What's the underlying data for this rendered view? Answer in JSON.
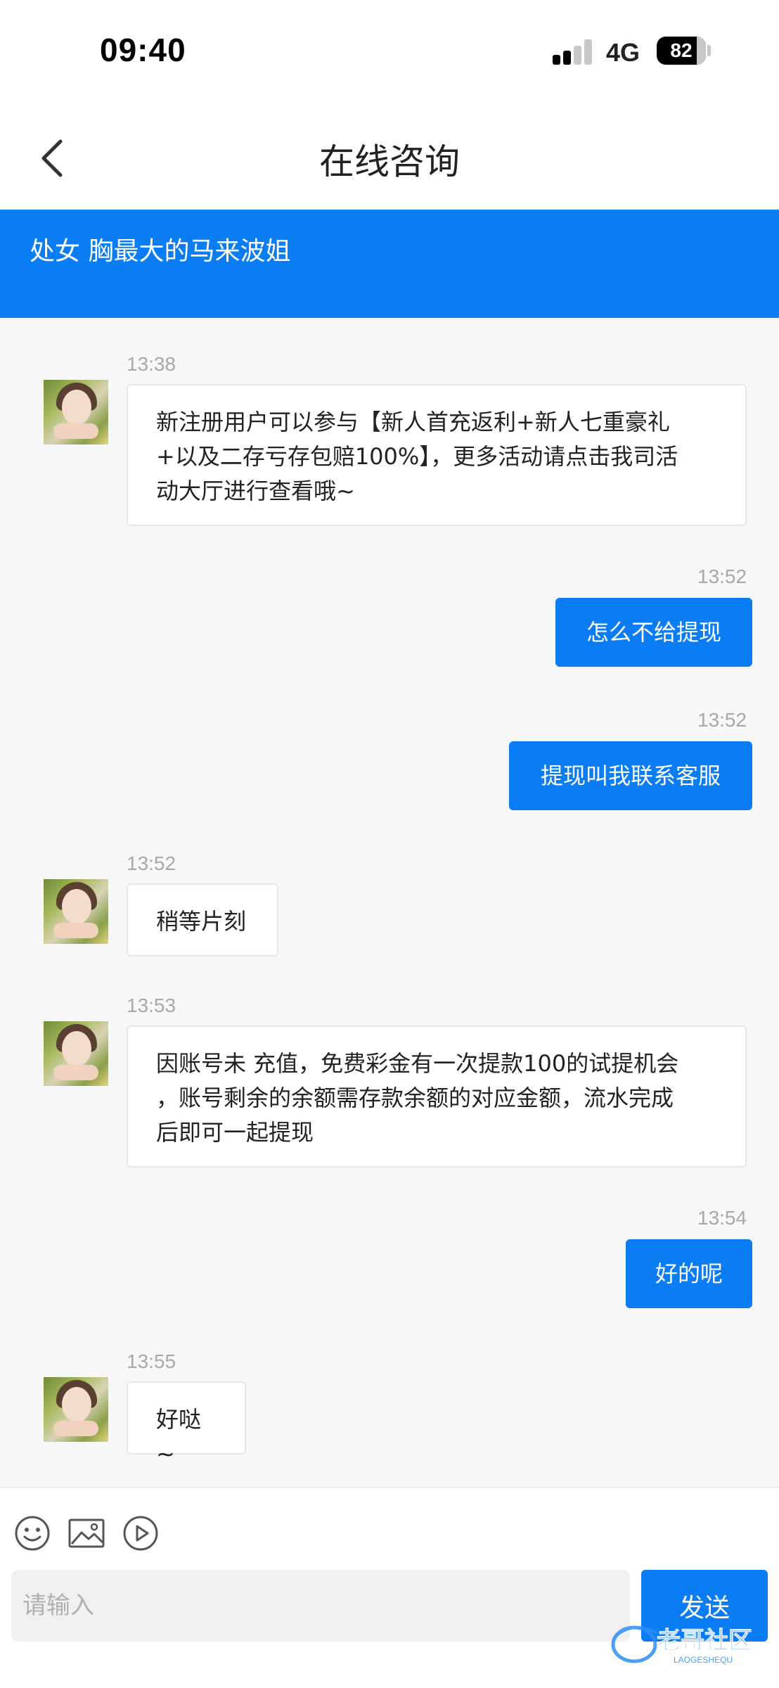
{
  "status_bar": {
    "time": "09:40",
    "network": "4G",
    "battery": "82",
    "battery_level": 0.82
  },
  "header": {
    "title": "在线咨询",
    "back_icon": "chevron-left-icon"
  },
  "banner": {
    "text": "处女 胸最大的马来波姐"
  },
  "messages": [
    {
      "side": "left",
      "time": "13:38",
      "text_lines": [
        "新注册用户可以参与【新人首充返利+新人七重豪礼",
        "+以及二存亏存包赔100%】，更多活动请点击我司活",
        "动大厅进行查看哦~"
      ]
    },
    {
      "side": "right",
      "time": "13:52",
      "text": "怎么不给提现"
    },
    {
      "side": "right",
      "time": "13:52",
      "text": "提现叫我联系客服"
    },
    {
      "side": "left",
      "time": "13:52",
      "text_lines": [
        "稍等片刻"
      ]
    },
    {
      "side": "left",
      "time": "13:53",
      "text_lines": [
        "因账号未 充值，免费彩金有一次提款100的试提机会",
        "，账号剩余的余额需存款余额的对应金额，流水完成",
        "后即可一起提现"
      ]
    },
    {
      "side": "right",
      "time": "13:54",
      "text": "好的呢"
    },
    {
      "side": "left",
      "time": "13:55",
      "text_lines": [
        "好哒~"
      ]
    }
  ],
  "input": {
    "placeholder": "请输入",
    "send_label": "发送",
    "tools": [
      "emoji-icon",
      "image-icon",
      "play-icon"
    ]
  },
  "watermark": {
    "text": "老哥社区",
    "sub": "LAOGESHEQU"
  },
  "colors": {
    "accent": "#0a7cf4",
    "background": "#f7f7f9"
  }
}
